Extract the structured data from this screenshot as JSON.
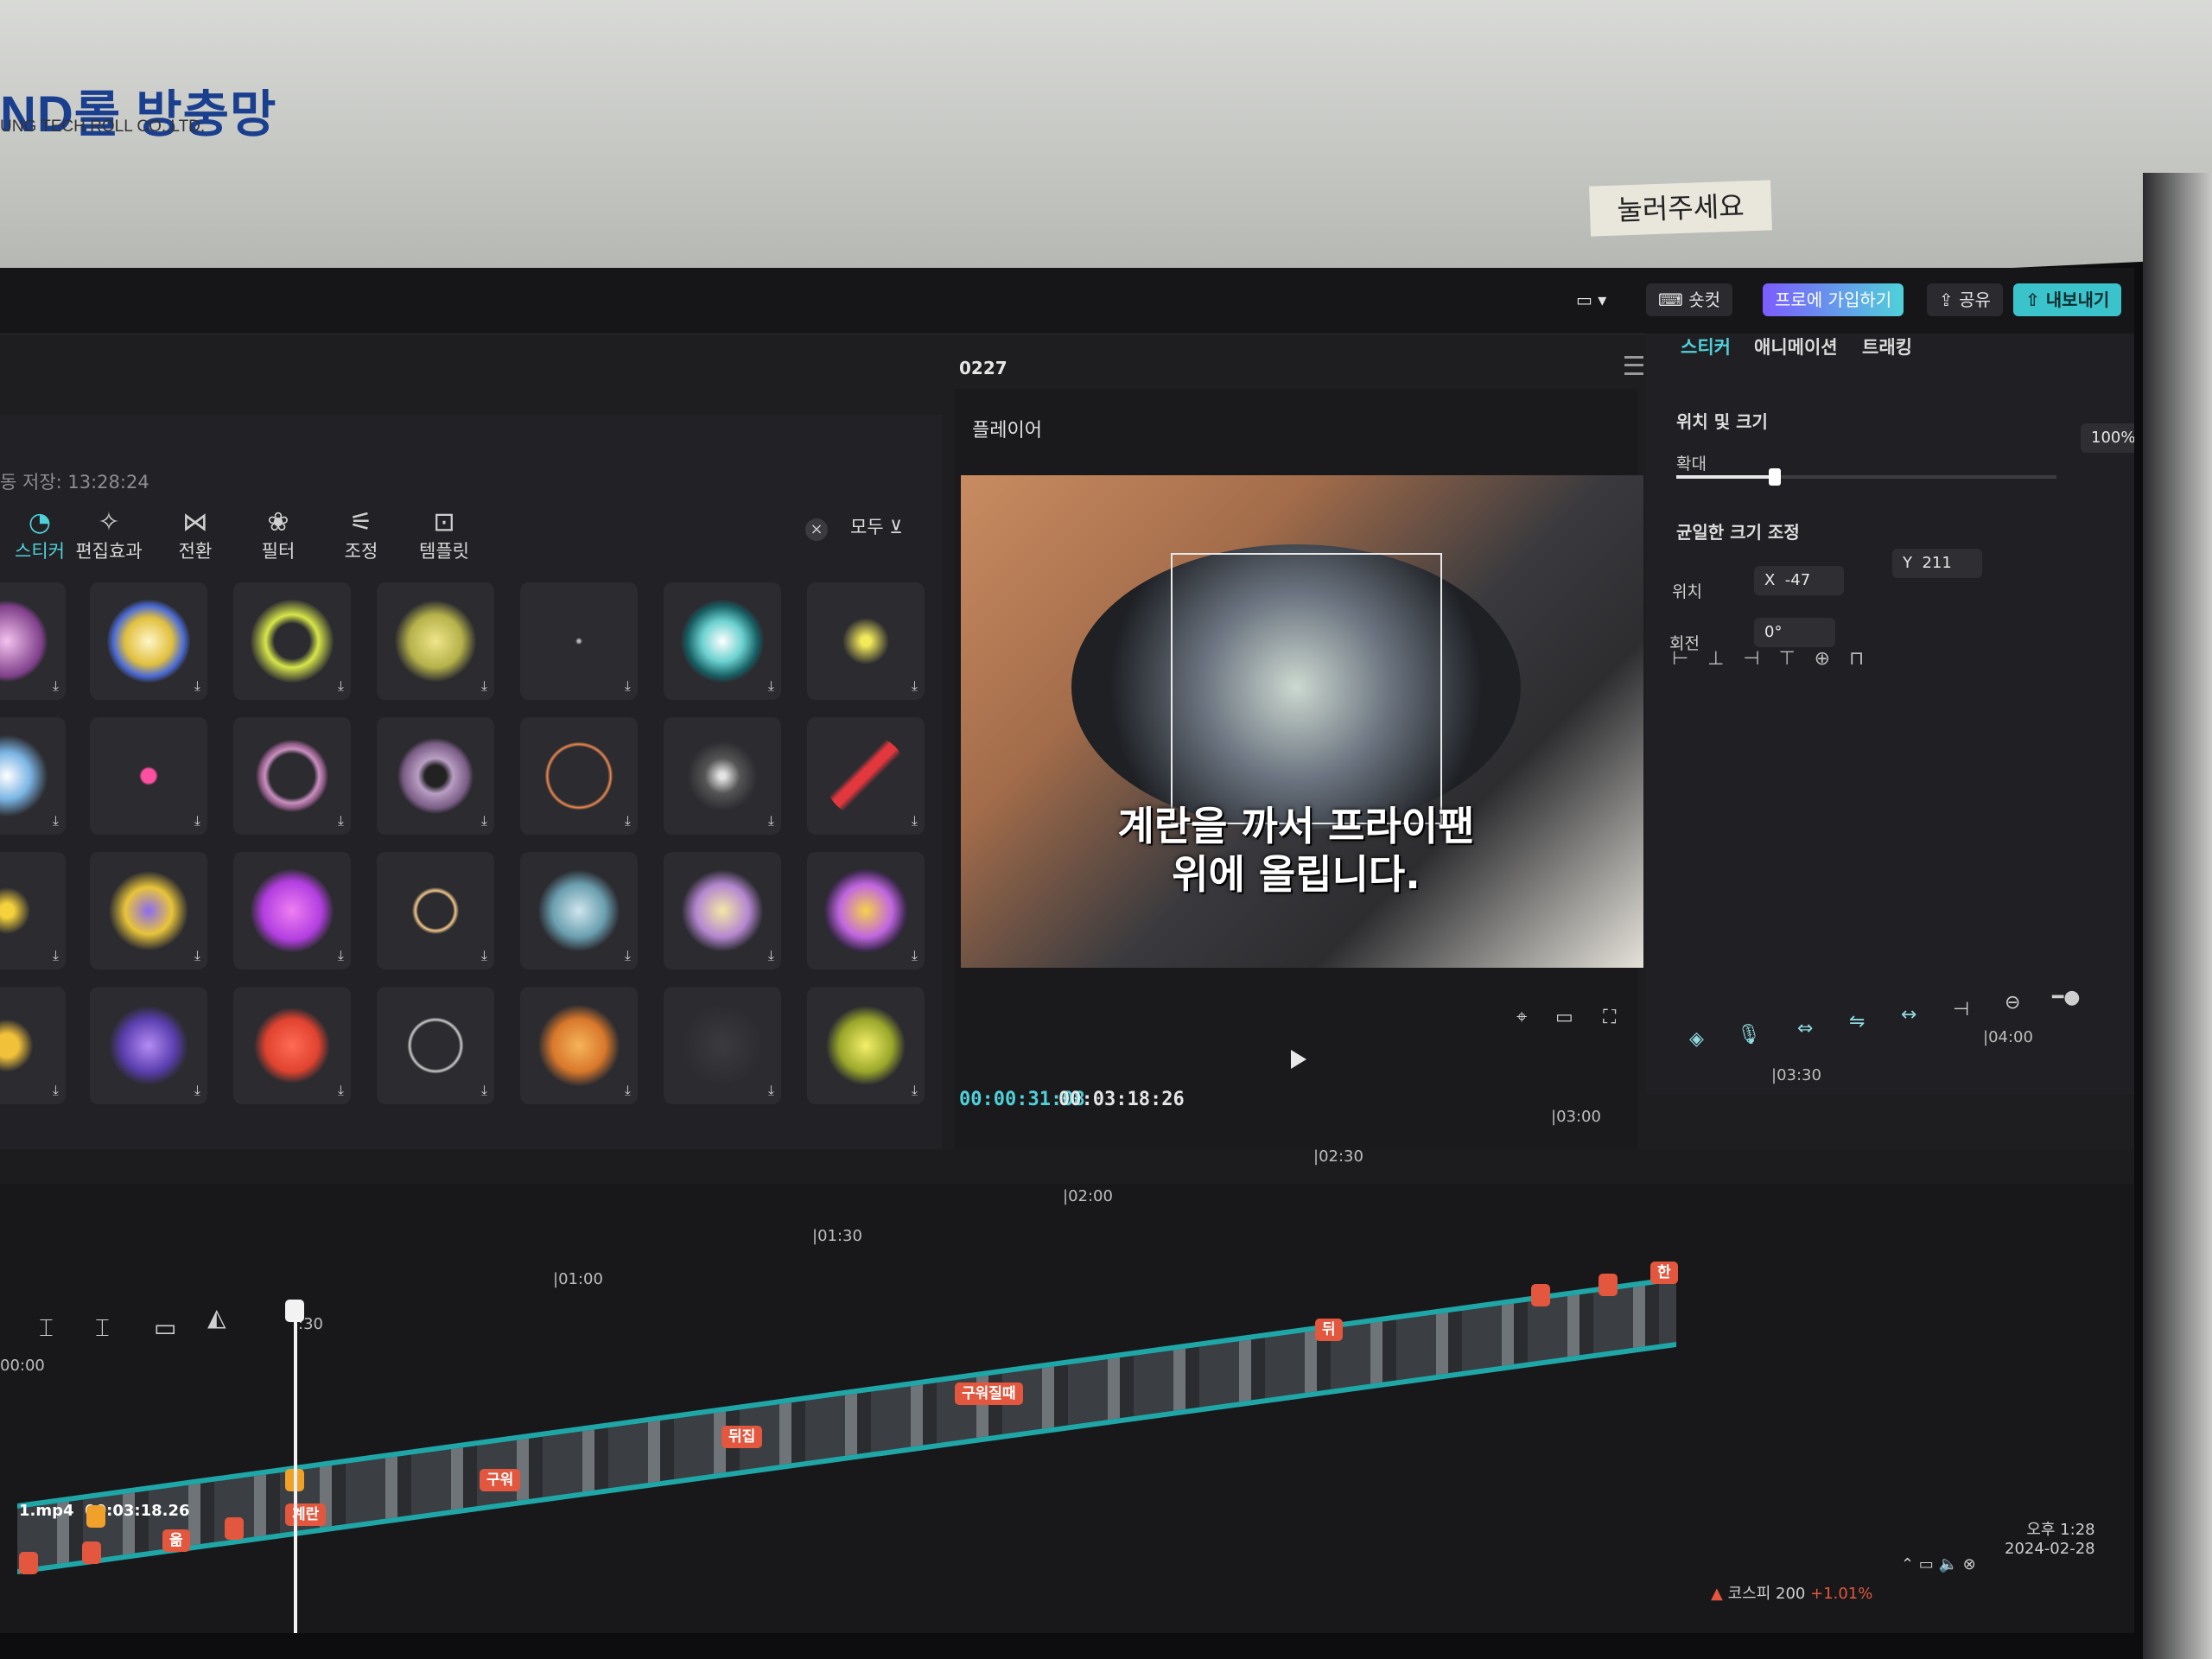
{
  "environment": {
    "sign_brand": "ND롤 방충망",
    "sign_sub": "UNG TECH ROLL CO.,LTD.",
    "sticky_note": "눌러주세요"
  },
  "titlebar": {
    "shortcut": "숏컷",
    "pro_join": "프로에 가입하기",
    "share": "공유",
    "export": "내보내기",
    "accent": "#3bc3cc"
  },
  "project": {
    "title": "0227"
  },
  "media": {
    "autosave": "동 저장: 13:28:24",
    "tabs": [
      {
        "label": "스티커",
        "icon": "sticker-icon"
      },
      {
        "label": "편집효과",
        "icon": "effects-icon"
      },
      {
        "label": "전환",
        "icon": "transition-icon"
      },
      {
        "label": "필터",
        "icon": "filter-icon"
      },
      {
        "label": "조정",
        "icon": "adjust-icon"
      },
      {
        "label": "템플릿",
        "icon": "template-icon"
      }
    ],
    "filter_all": "모두"
  },
  "player": {
    "label": "플레이어",
    "caption_line1": "계란을 까서 프라이팬",
    "caption_line2": "위에 올립니다.",
    "current_time": "00:00:31:08",
    "total_time": "00:03:18:26"
  },
  "properties": {
    "tabs": [
      "스티커",
      "애니메이션",
      "트래킹"
    ],
    "section_position_size": "위치 및 크기",
    "scale_label": "확대",
    "scale_value": "100%",
    "scale_level": 0.26,
    "uniform_scale": "균일한 크기 조정",
    "position_label": "위치",
    "x_label": "X",
    "x_value": "-47",
    "y_label": "Y",
    "y_value": "211",
    "rotation_label": "회전",
    "rotation_value": "0°"
  },
  "timeline": {
    "ticks": [
      "00:00",
      ":30",
      "|01:00",
      "|01:30",
      "|02:00",
      "|02:30",
      "|03:00",
      "|03:30",
      "|04:00"
    ],
    "clip_name": "1.mp4",
    "clip_duration": "00:03:18.26",
    "markers": [
      "한",
      "뒤",
      "구워질때",
      "뒤집",
      "구워",
      "계란",
      "옮"
    ]
  },
  "taskbar": {
    "kospi": "코스피",
    "kospi_value": "200",
    "kospi_change": "+1.01%",
    "time": "오후 1:28",
    "date": "2024-02-28"
  }
}
